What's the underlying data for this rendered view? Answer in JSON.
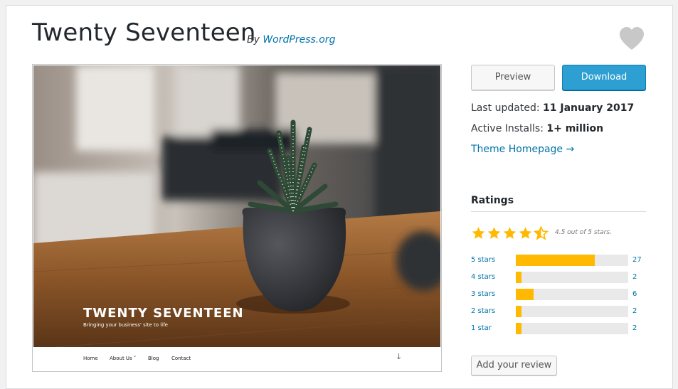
{
  "theme": {
    "title": "Twenty Seventeen",
    "by_prefix": "By",
    "author": "WordPress.org"
  },
  "screenshot": {
    "site_title": "TWENTY SEVENTEEN",
    "tagline": "Bringing your business' site to life",
    "nav": [
      "Home",
      "About Us ˅",
      "Blog",
      "Contact"
    ],
    "scroll_icon": "arrow-down-icon"
  },
  "actions": {
    "preview_label": "Preview",
    "download_label": "Download"
  },
  "meta": {
    "last_updated_label": "Last updated:",
    "last_updated_value": "11 January 2017",
    "active_installs_label": "Active Installs:",
    "active_installs_value": "1+ million",
    "homepage_label": "Theme Homepage →"
  },
  "ratings": {
    "heading": "Ratings",
    "average": 4.5,
    "summary": "4.5 out of 5 stars.",
    "breakdown": [
      {
        "label": "5 stars",
        "count": "27",
        "fraction": 0.7
      },
      {
        "label": "4 stars",
        "count": "2",
        "fraction": 0.05
      },
      {
        "label": "3 stars",
        "count": "6",
        "fraction": 0.16
      },
      {
        "label": "2 stars",
        "count": "2",
        "fraction": 0.05
      },
      {
        "label": "1 star",
        "count": "2",
        "fraction": 0.05
      }
    ],
    "add_review_label": "Add your review"
  },
  "colors": {
    "accent": "#0073aa",
    "download_bg": "#2e9fd2",
    "star": "#ffb900"
  }
}
